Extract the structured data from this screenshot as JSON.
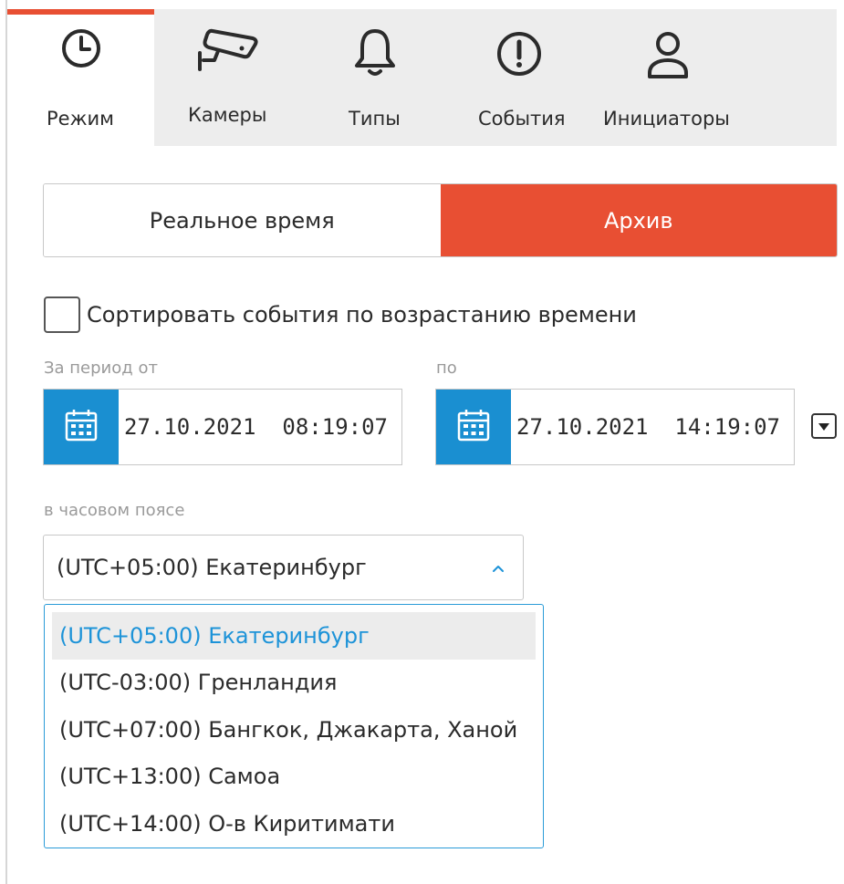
{
  "tabs": [
    {
      "label": "Режим",
      "icon": "clock-icon"
    },
    {
      "label": "Камеры",
      "icon": "camera-icon"
    },
    {
      "label": "Типы",
      "icon": "bell-icon"
    },
    {
      "label": "События",
      "icon": "alert-icon"
    },
    {
      "label": "Инициаторы",
      "icon": "user-icon"
    }
  ],
  "active_tab": "Режим",
  "mode": {
    "realtime_label": "Реальное время",
    "archive_label": "Архив",
    "selected": "Архив"
  },
  "sort_checkbox": {
    "label": "Сортировать события по возрастанию времени",
    "checked": false
  },
  "period": {
    "from_label": "За период от",
    "to_label": "по",
    "from_value": "27.10.2021  08:19:07",
    "to_value": "27.10.2021  14:19:07"
  },
  "timezone": {
    "label": "в часовом поясе",
    "value": "(UTC+05:00) Екатеринбург",
    "options": [
      "(UTC+05:00) Екатеринбург",
      "(UTC-03:00) Гренландия",
      "(UTC+07:00) Бангкок, Джакарта, Ханой",
      "(UTC+13:00) Самоа",
      "(UTC+14:00) О-в Киритимати"
    ]
  },
  "colors": {
    "accent": "#e84f33",
    "calendar": "#1a8fd1",
    "selected_text": "#1d93d8"
  }
}
